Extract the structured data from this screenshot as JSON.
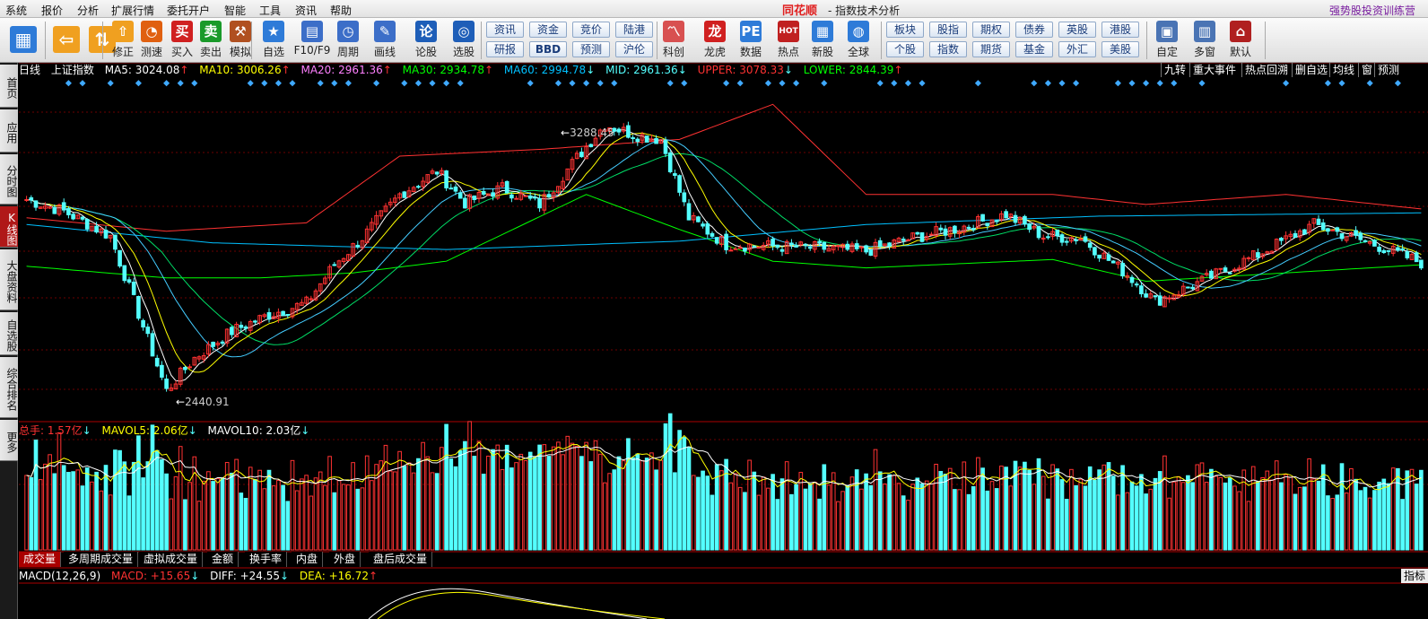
{
  "menubar": {
    "items": [
      "系统",
      "报价",
      "分析",
      "扩展行情",
      "委托开户",
      "智能",
      "工具",
      "资讯",
      "帮助"
    ],
    "brand": "同花顺",
    "window_title": "- 指数技术分析",
    "training": "强势股投资训练营"
  },
  "toolbar": {
    "big": [
      {
        "label": "修正",
        "icon": "⇧"
      },
      {
        "label": "测速",
        "icon": "◔"
      },
      {
        "label": "买入",
        "icon": "买"
      },
      {
        "label": "卖出",
        "icon": "卖"
      },
      {
        "label": "模拟",
        "icon": "⚒"
      },
      {
        "label": "自选",
        "icon": "★"
      },
      {
        "label": "F10/F9",
        "icon": "▤"
      },
      {
        "label": "周期",
        "icon": "◷"
      },
      {
        "label": "画线",
        "icon": "✎"
      },
      {
        "label": "论股",
        "icon": "论"
      },
      {
        "label": "选股",
        "icon": "◎"
      },
      {
        "label": "科创",
        "icon": "〽"
      },
      {
        "label": "龙虎",
        "icon": "龙"
      },
      {
        "label": "数据",
        "icon": "PE"
      },
      {
        "label": "热点",
        "icon": "HOT"
      },
      {
        "label": "新股",
        "icon": "▦"
      },
      {
        "label": "全球",
        "icon": "◍"
      },
      {
        "label": "自定",
        "icon": "▣"
      },
      {
        "label": "多窗",
        "icon": "▥"
      },
      {
        "label": "默认",
        "icon": "⌂"
      }
    ],
    "small_top": [
      "资讯",
      "资金",
      "竞价",
      "陆港"
    ],
    "small_bottom": [
      "研报",
      "BBD",
      "预测",
      "沪伦"
    ],
    "market_top": [
      "板块",
      "股指",
      "期权",
      "债券",
      "英股",
      "港股"
    ],
    "market_bottom": [
      "个股",
      "指数",
      "期货",
      "基金",
      "外汇",
      "美股"
    ]
  },
  "left_tabs": [
    "首页",
    "应用",
    "分时图",
    "K线图",
    "大盘资料",
    "自选股",
    "综合排名",
    "更多"
  ],
  "indicators": {
    "period": "日线",
    "name": "上证指数",
    "ma5": "MA5: 3024.08",
    "ma10": "MA10: 3006.26",
    "ma20": "MA20: 2961.36",
    "ma30": "MA30: 2934.78",
    "ma60": "MA60: 2994.78",
    "mid": "MID: 2961.36",
    "upper": "UPPER: 3078.33",
    "lower": "LOWER: 2844.39"
  },
  "right_buttons": [
    "九转",
    "重大事件",
    "热点回溯",
    "删自选",
    "均线",
    "窗",
    "预测"
  ],
  "annotations": {
    "high": "3288.45",
    "low": "2440.91"
  },
  "volume_info": {
    "total": "总手: 1.57亿",
    "mavol5": "MAVOL5: 2.06亿",
    "mavol10": "MAVOL10: 2.03亿"
  },
  "volume_tabs": [
    "成交量",
    "多周期成交量",
    "虚拟成交量",
    "金额",
    "换手率",
    "内盘",
    "外盘",
    "盘后成交量"
  ],
  "macd_info": {
    "name": "MACD(12,26,9)",
    "macd": "MACD: +15.65",
    "diff": "DIFF: +24.55",
    "dea": "DEA: +16.72"
  },
  "indicator_button": "指标",
  "colors": {
    "up": "#ff3232",
    "down": "#54ffff",
    "ma5": "#ffffff",
    "ma10": "#ffff00",
    "ma20": "#ff80ff",
    "ma30": "#00ff00",
    "ma60": "#00c0ff",
    "upper": "#ff3232",
    "lower": "#00ff00",
    "mid": "#54ffff"
  },
  "chart_data": {
    "type": "candlestick",
    "title": "上证指数 日线",
    "series_keypoints": {
      "close": [
        [
          0,
          3035
        ],
        [
          8,
          3000
        ],
        [
          18,
          2925
        ],
        [
          30,
          2462
        ],
        [
          36,
          2560
        ],
        [
          44,
          2640
        ],
        [
          52,
          2690
        ],
        [
          60,
          2725
        ],
        [
          66,
          2840
        ],
        [
          72,
          2920
        ],
        [
          80,
          3050
        ],
        [
          88,
          3120
        ],
        [
          94,
          3025
        ],
        [
          102,
          3070
        ],
        [
          110,
          3020
        ],
        [
          118,
          3160
        ],
        [
          124,
          3260
        ],
        [
          130,
          3230
        ],
        [
          136,
          3215
        ],
        [
          142,
          2980
        ],
        [
          150,
          2900
        ],
        [
          160,
          2895
        ],
        [
          170,
          2890
        ],
        [
          180,
          2880
        ],
        [
          190,
          2920
        ],
        [
          200,
          2950
        ],
        [
          210,
          2990
        ],
        [
          218,
          2925
        ],
        [
          226,
          2920
        ],
        [
          236,
          2810
        ],
        [
          242,
          2730
        ],
        [
          252,
          2790
        ],
        [
          264,
          2870
        ],
        [
          276,
          2960
        ],
        [
          290,
          2895
        ],
        [
          300,
          2840
        ]
      ],
      "ma60": [
        [
          0,
          2960
        ],
        [
          40,
          2905
        ],
        [
          90,
          2885
        ],
        [
          140,
          2910
        ],
        [
          180,
          2960
        ],
        [
          230,
          2985
        ],
        [
          300,
          2995
        ]
      ],
      "upper": [
        [
          0,
          2980
        ],
        [
          30,
          2940
        ],
        [
          60,
          2965
        ],
        [
          80,
          3165
        ],
        [
          110,
          3185
        ],
        [
          140,
          3215
        ],
        [
          160,
          3320
        ],
        [
          180,
          3050
        ],
        [
          220,
          3050
        ],
        [
          240,
          3020
        ],
        [
          270,
          3050
        ],
        [
          300,
          3005
        ]
      ],
      "lower": [
        [
          0,
          2835
        ],
        [
          30,
          2800
        ],
        [
          50,
          2800
        ],
        [
          70,
          2815
        ],
        [
          90,
          2850
        ],
        [
          120,
          3050
        ],
        [
          140,
          2945
        ],
        [
          160,
          2850
        ],
        [
          180,
          2830
        ],
        [
          220,
          2855
        ],
        [
          240,
          2790
        ],
        [
          270,
          2815
        ],
        [
          300,
          2840
        ]
      ]
    },
    "volume_max": "3.2亿"
  }
}
